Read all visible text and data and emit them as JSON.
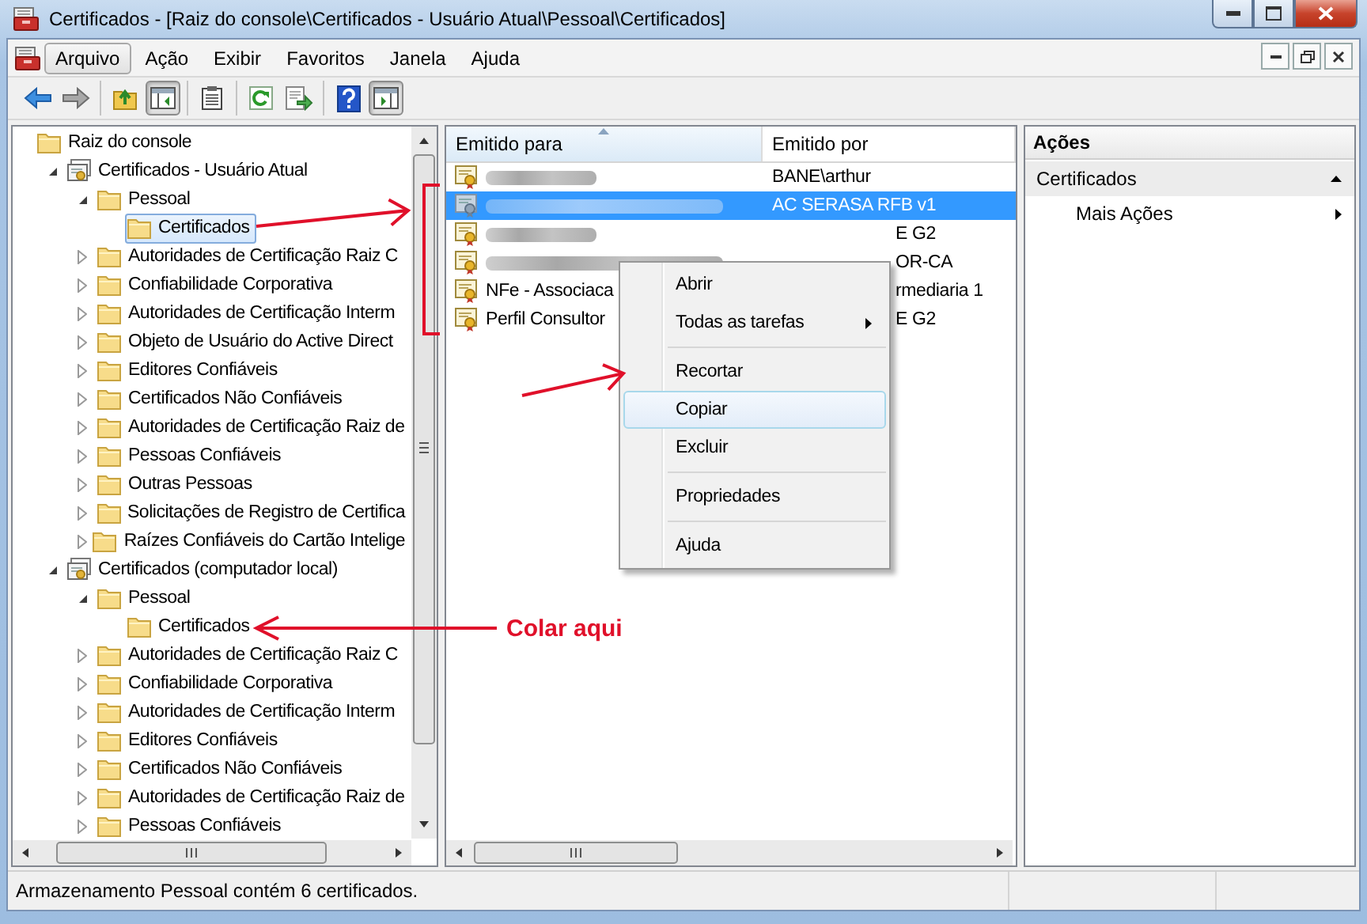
{
  "window": {
    "title": "Certificados - [Raiz do console\\Certificados - Usuário Atual\\Pessoal\\Certificados]"
  },
  "menu": [
    {
      "label": "Arquivo",
      "selected": true
    },
    {
      "label": "Ação",
      "selected": false
    },
    {
      "label": "Exibir",
      "selected": false
    },
    {
      "label": "Favoritos",
      "selected": false
    },
    {
      "label": "Janela",
      "selected": false
    },
    {
      "label": "Ajuda",
      "selected": false
    }
  ],
  "toolbar": [
    [
      {
        "kind": "back",
        "pressed": false
      },
      {
        "kind": "forward",
        "pressed": false
      }
    ],
    [
      {
        "kind": "up",
        "pressed": false
      },
      {
        "kind": "tree",
        "pressed": true
      }
    ],
    [
      {
        "kind": "properties",
        "pressed": false
      }
    ],
    [
      {
        "kind": "refresh",
        "pressed": false
      },
      {
        "kind": "export",
        "pressed": false
      }
    ],
    [
      {
        "kind": "help",
        "pressed": false
      },
      {
        "kind": "actionpane",
        "pressed": true
      }
    ]
  ],
  "tree": [
    {
      "label": "Raiz do console",
      "kind": "folder",
      "selected": false,
      "children": [
        {
          "label": "Certificados - Usuário Atual",
          "kind": "store",
          "expanded": true,
          "selected": false,
          "children": [
            {
              "label": "Pessoal",
              "kind": "folder",
              "expanded": true,
              "selected": false,
              "children": [
                {
                  "label": "Certificados",
                  "kind": "folder",
                  "selected": true
                }
              ]
            },
            {
              "label": "Autoridades de Certificação Raiz C",
              "kind": "folder",
              "expanded": false,
              "selected": false
            },
            {
              "label": "Confiabilidade Corporativa",
              "kind": "folder",
              "expanded": false,
              "selected": false
            },
            {
              "label": "Autoridades de Certificação Interm",
              "kind": "folder",
              "expanded": false,
              "selected": false
            },
            {
              "label": "Objeto de Usuário do Active Direct",
              "kind": "folder",
              "expanded": false,
              "selected": false
            },
            {
              "label": "Editores Confiáveis",
              "kind": "folder",
              "expanded": false,
              "selected": false
            },
            {
              "label": "Certificados Não Confiáveis",
              "kind": "folder",
              "expanded": false,
              "selected": false
            },
            {
              "label": "Autoridades de Certificação Raiz de",
              "kind": "folder",
              "expanded": false,
              "selected": false
            },
            {
              "label": "Pessoas Confiáveis",
              "kind": "folder",
              "expanded": false,
              "selected": false
            },
            {
              "label": "Outras Pessoas",
              "kind": "folder",
              "expanded": false,
              "selected": false
            },
            {
              "label": "Solicitações de Registro de Certifica",
              "kind": "folder",
              "expanded": false,
              "selected": false
            },
            {
              "label": "Raízes Confiáveis do Cartão Intelige",
              "kind": "folder",
              "expanded": false,
              "selected": false
            }
          ]
        },
        {
          "label": "Certificados (computador local)",
          "kind": "store",
          "expanded": true,
          "selected": false,
          "children": [
            {
              "label": "Pessoal",
              "kind": "folder",
              "expanded": true,
              "selected": false,
              "children": [
                {
                  "label": "Certificados",
                  "kind": "folder",
                  "selected": false
                }
              ]
            },
            {
              "label": "Autoridades de Certificação Raiz C",
              "kind": "folder",
              "expanded": false,
              "selected": false
            },
            {
              "label": "Confiabilidade Corporativa",
              "kind": "folder",
              "expanded": false,
              "selected": false
            },
            {
              "label": "Autoridades de Certificação Interm",
              "kind": "folder",
              "expanded": false,
              "selected": false
            },
            {
              "label": "Editores Confiáveis",
              "kind": "folder",
              "expanded": false,
              "selected": false
            },
            {
              "label": "Certificados Não Confiáveis",
              "kind": "folder",
              "expanded": false,
              "selected": false
            },
            {
              "label": "Autoridades de Certificação Raiz de",
              "kind": "folder",
              "expanded": false,
              "selected": false
            },
            {
              "label": "Pessoas Confiáveis",
              "kind": "folder",
              "expanded": false,
              "selected": false
            }
          ]
        }
      ]
    }
  ],
  "list": {
    "columns": [
      {
        "label": "Emitido para",
        "sorted": true
      },
      {
        "label": "Emitido por",
        "sorted": false
      }
    ],
    "rows": [
      {
        "blurred": true,
        "issuer": "BANE\\arthur",
        "covered": false,
        "selected": false
      },
      {
        "blurred": true,
        "issuer": "AC SERASA RFB v1",
        "covered": false,
        "selected": true
      },
      {
        "blurred": true,
        "issuer": "E G2",
        "covered": true,
        "selected": false
      },
      {
        "blurred": true,
        "issuer": "OR-CA",
        "covered": true,
        "selected": false
      },
      {
        "name": "NFe - Associaca",
        "blurred": false,
        "issuer": "rmediaria 1",
        "covered": true,
        "selected": false
      },
      {
        "name": "Perfil Consultor",
        "blurred": false,
        "issuer": "E G2",
        "covered": true,
        "selected": false
      }
    ]
  },
  "context_menu": [
    [
      {
        "label": "Abrir",
        "submenu": false,
        "selected": false
      },
      {
        "label": "Todas as tarefas",
        "submenu": true,
        "selected": false
      }
    ],
    [
      {
        "label": "Recortar",
        "submenu": false,
        "selected": false
      },
      {
        "label": "Copiar",
        "submenu": false,
        "selected": true
      },
      {
        "label": "Excluir",
        "submenu": false,
        "selected": false
      }
    ],
    [
      {
        "label": "Propriedades",
        "submenu": false,
        "selected": false
      }
    ],
    [
      {
        "label": "Ajuda",
        "submenu": false,
        "selected": false
      }
    ]
  ],
  "actions": {
    "title": "Ações",
    "sections": [
      {
        "label": "Certificados",
        "expanded": true,
        "items": [
          {
            "label": "Mais Ações",
            "submenu": true
          }
        ]
      }
    ]
  },
  "annotation": {
    "label": "Colar aqui"
  },
  "status_bar": {
    "text": "Armazenamento Pessoal contém 6 certificados."
  }
}
